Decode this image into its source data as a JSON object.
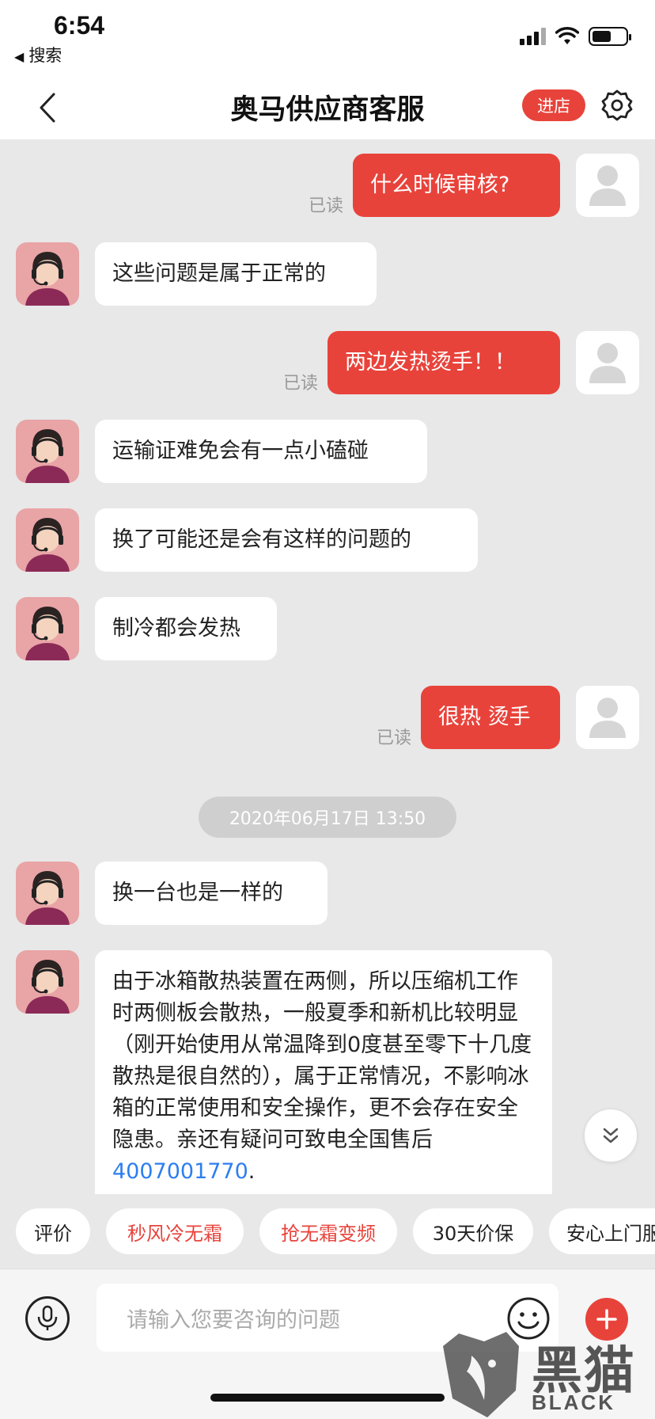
{
  "status_bar": {
    "time": "6:54",
    "back_app": "搜索"
  },
  "header": {
    "title": "奥马供应商客服",
    "shop_button": "进店"
  },
  "messages": [
    {
      "side": "out",
      "text": "什么时候审核?",
      "read": "已读"
    },
    {
      "side": "in",
      "text": "这些问题是属于正常的"
    },
    {
      "side": "out",
      "text": "两边发热烫手！！",
      "read": "已读"
    },
    {
      "side": "in",
      "text": "运输证难免会有一点小磕碰"
    },
    {
      "side": "in",
      "text": "换了可能还是会有这样的问题的"
    },
    {
      "side": "in",
      "text": "制冷都会发热"
    },
    {
      "side": "out",
      "text": "很热 烫手",
      "read": "已读"
    },
    {
      "side": "in",
      "text": "换一台也是一样的"
    },
    {
      "side": "in",
      "text": "由于冰箱散热装置在两侧，所以压缩机工作时两侧板会散热，一般夏季和新机比较明显（刚开始使用从常温降到0度甚至零下十几度散热是很自然的），属于正常情况，不影响冰箱的正常使用和安全操作，更不会存在安全隐患。亲还有疑问可致电全国售后",
      "phone": "4007001770",
      "suffix": "."
    }
  ],
  "timestamp": "2020年06月17日 13:50",
  "quick_chips": [
    {
      "label": "评价",
      "highlight": false
    },
    {
      "label": "秒风冷无霜",
      "highlight": true
    },
    {
      "label": "抢无霜变频",
      "highlight": true
    },
    {
      "label": "30天价保",
      "highlight": false
    },
    {
      "label": "安心上门服",
      "highlight": false
    }
  ],
  "input": {
    "placeholder": "请输入您要咨询的问题"
  },
  "watermark": {
    "brand_cn": "黑猫",
    "brand_en": "BLACK CAT"
  },
  "colors": {
    "accent": "#e8433b",
    "link": "#2d7ef0",
    "background": "#e8e8e8"
  }
}
